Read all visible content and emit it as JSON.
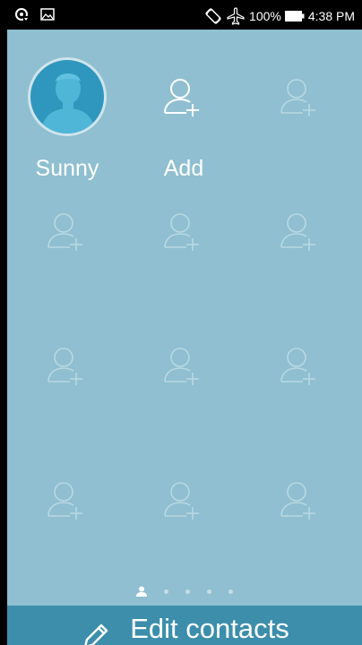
{
  "status_bar": {
    "battery": "100%",
    "time": "4:38 PM",
    "left_icons": [
      "sync-status-icon",
      "image-notification-icon"
    ],
    "right_icons": [
      "rotation-lock-icon",
      "airplane-mode-icon",
      "battery-icon"
    ]
  },
  "contacts": {
    "rows": [
      [
        {
          "type": "contact",
          "name": "Sunny"
        },
        {
          "type": "add",
          "name": "Add"
        },
        {
          "type": "empty"
        }
      ],
      [
        {
          "type": "empty"
        },
        {
          "type": "empty"
        },
        {
          "type": "empty"
        }
      ],
      [
        {
          "type": "empty"
        },
        {
          "type": "empty"
        },
        {
          "type": "empty"
        }
      ],
      [
        {
          "type": "empty"
        },
        {
          "type": "empty"
        },
        {
          "type": "empty"
        }
      ]
    ]
  },
  "pager": {
    "page_count": 5,
    "current_page": 1
  },
  "bottom_bar": {
    "label": "Edit contacts",
    "icon": "pencil-icon"
  },
  "colors": {
    "background": "#8fbfd0",
    "bottom_bar": "#3c8eab",
    "avatar": "#2f97bd",
    "icon_active": "#ffffff",
    "icon_faded": "#b9d8e3"
  }
}
